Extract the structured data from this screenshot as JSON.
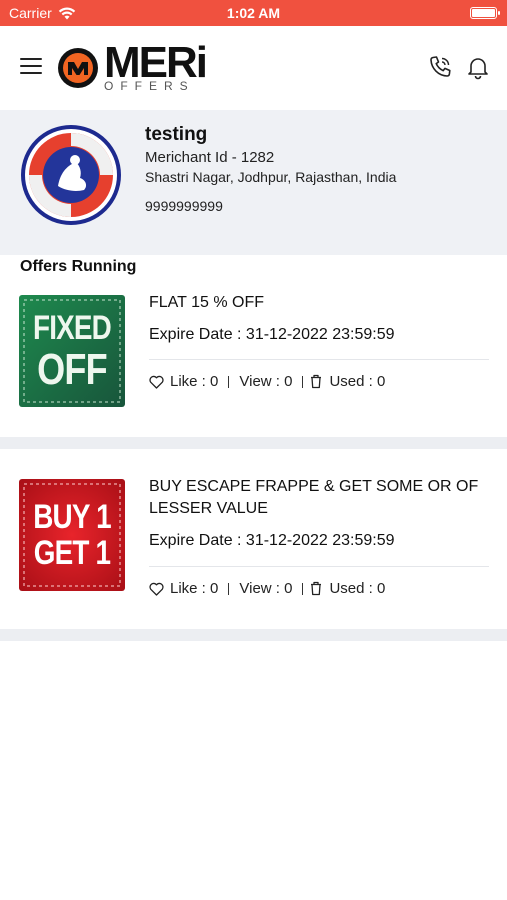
{
  "status_bar": {
    "carrier": "Carrier",
    "time": "1:02 AM"
  },
  "header": {
    "logo_word": "MERi",
    "logo_sub": "OFFERS",
    "icons": [
      "menu-icon",
      "phone-icon",
      "bell-icon"
    ]
  },
  "merchant": {
    "name": "testing",
    "id_text": "Merichant Id - 1282",
    "address": "Shastri Nagar, Jodhpur, Rajasthan, India",
    "phone": "9999999999"
  },
  "section_title": "Offers Running",
  "offers": [
    {
      "badge_line1": "FIXED",
      "badge_line2": "OFF",
      "title": "FLAT 15 % OFF",
      "expire": "Expire Date : 31-12-2022 23:59:59",
      "like": "Like : 0",
      "view": "View : 0",
      "used": "Used : 0"
    },
    {
      "badge_line1": "BUY 1",
      "badge_line2": "GET 1",
      "title": "BUY ESCAPE FRAPPE & GET SOME OR OF LESSER VALUE",
      "expire": "Expire Date : 31-12-2022 23:59:59",
      "like": "Like : 0",
      "view": "View : 0",
      "used": "Used : 0"
    }
  ],
  "colors": {
    "status_bar": "#f0513f",
    "fixed_off_green": "#1f6b47",
    "buy1get1_red": "#d0181f",
    "logo_orange": "#f26522"
  }
}
